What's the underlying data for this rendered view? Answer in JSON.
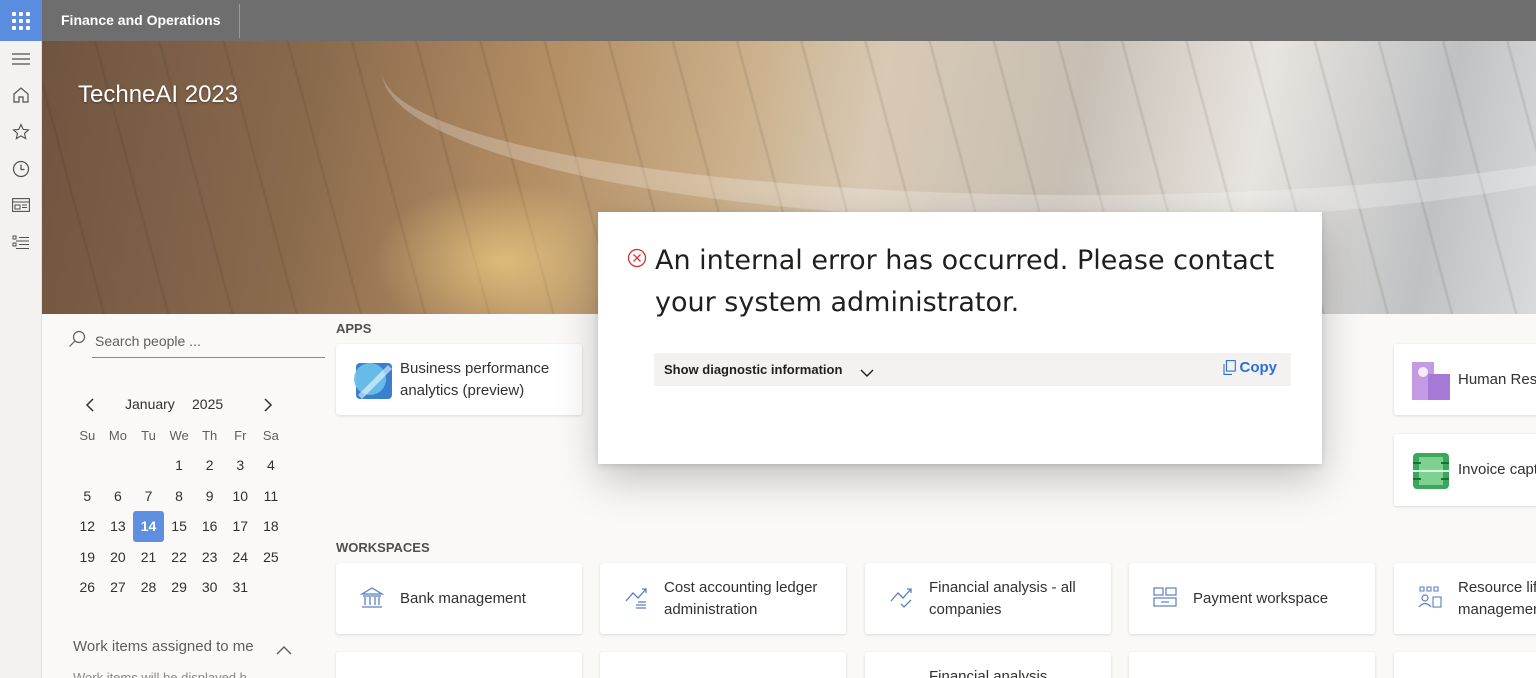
{
  "header": {
    "app_title": "Finance and Operations",
    "waffle_icon": "app-launcher-icon"
  },
  "leftnav": {
    "items": [
      {
        "name": "hamburger-icon"
      },
      {
        "name": "home-icon"
      },
      {
        "name": "favorites-icon"
      },
      {
        "name": "recent-icon"
      },
      {
        "name": "workspaces-icon"
      },
      {
        "name": "modules-icon"
      }
    ]
  },
  "banner": {
    "title": "TechneAI 2023"
  },
  "search": {
    "placeholder": "Search people ..."
  },
  "calendar": {
    "month": "January",
    "year": "2025",
    "weekdays": [
      "Su",
      "Mo",
      "Tu",
      "We",
      "Th",
      "Fr",
      "Sa"
    ],
    "days": [
      "",
      "",
      "",
      "1",
      "2",
      "3",
      "4",
      "5",
      "6",
      "7",
      "8",
      "9",
      "10",
      "11",
      "12",
      "13",
      "14",
      "15",
      "16",
      "17",
      "18",
      "19",
      "20",
      "21",
      "22",
      "23",
      "24",
      "25",
      "26",
      "27",
      "28",
      "29",
      "30",
      "31",
      ""
    ],
    "today": "14"
  },
  "workitems": {
    "title": "Work items assigned to me",
    "subtitle": "Work items will be displayed h"
  },
  "apps": {
    "label": "APPS",
    "tiles": [
      {
        "label": "Business performance analytics (preview)"
      },
      {
        "label": "Human Res"
      },
      {
        "label": "Invoice capt"
      }
    ]
  },
  "workspaces": {
    "label": "WORKSPACES",
    "tiles": [
      {
        "label": "Bank management"
      },
      {
        "label": "Cost accounting ledger administration"
      },
      {
        "label": "Financial analysis - all companies"
      },
      {
        "label": "Payment workspace"
      },
      {
        "label": "Resource lif managemen"
      }
    ],
    "partial_label": "Financial analysis"
  },
  "dialog": {
    "message": "An internal error has occurred. Please contact your system administrator.",
    "diag_label": "Show diagnostic information",
    "copy_label": "Copy"
  },
  "colors": {
    "accent": "#2f6fd4",
    "today": "#5f8fe0",
    "topbar": "#6e6e6e",
    "error": "#d13438"
  }
}
